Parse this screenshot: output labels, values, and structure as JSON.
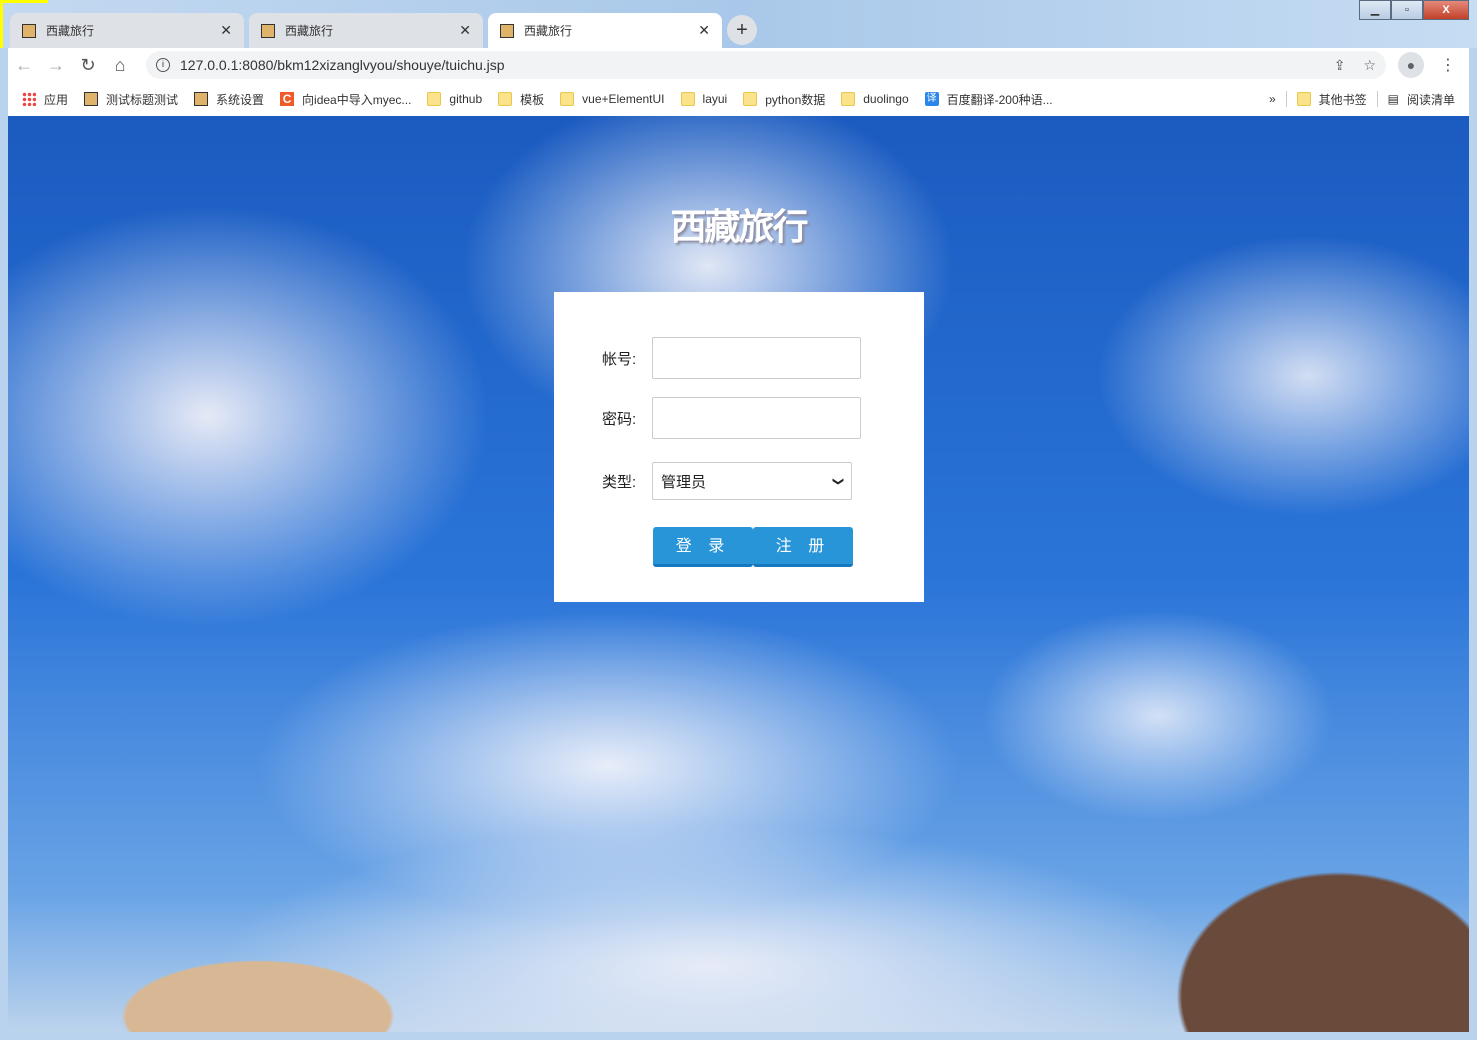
{
  "browser": {
    "tabs": [
      {
        "title": "西藏旅行",
        "active": false
      },
      {
        "title": "西藏旅行",
        "active": false
      },
      {
        "title": "西藏旅行",
        "active": true
      }
    ],
    "url": "127.0.0.1:8080/bkm12xizanglvyou/shouye/tuichu.jsp",
    "window_controls": {
      "minimize": "▁",
      "maximize": "▫",
      "close": "X"
    },
    "bookmarks": [
      {
        "label": "应用",
        "icon": "apps"
      },
      {
        "label": "测试标题测试",
        "icon": "tomcat"
      },
      {
        "label": "系统设置",
        "icon": "tomcat"
      },
      {
        "label": "向idea中导入myec...",
        "icon": "c"
      },
      {
        "label": "github",
        "icon": "folder"
      },
      {
        "label": "模板",
        "icon": "folder"
      },
      {
        "label": "vue+ElementUI",
        "icon": "folder"
      },
      {
        "label": "layui",
        "icon": "folder"
      },
      {
        "label": "python数据",
        "icon": "folder"
      },
      {
        "label": "duolingo",
        "icon": "folder"
      },
      {
        "label": "百度翻译-200种语...",
        "icon": "yi"
      }
    ],
    "more": "»",
    "other_bookmarks": "其他书签",
    "reading_list": "阅读清单",
    "yi_glyph": "译",
    "c_glyph": "C"
  },
  "page": {
    "site_title": "西藏旅行",
    "form": {
      "account_label": "帐号:",
      "account_value": "",
      "password_label": "密码:",
      "password_value": "",
      "type_label": "类型:",
      "type_selected": "管理员",
      "login_button": "登 录",
      "register_button": "注 册"
    }
  }
}
